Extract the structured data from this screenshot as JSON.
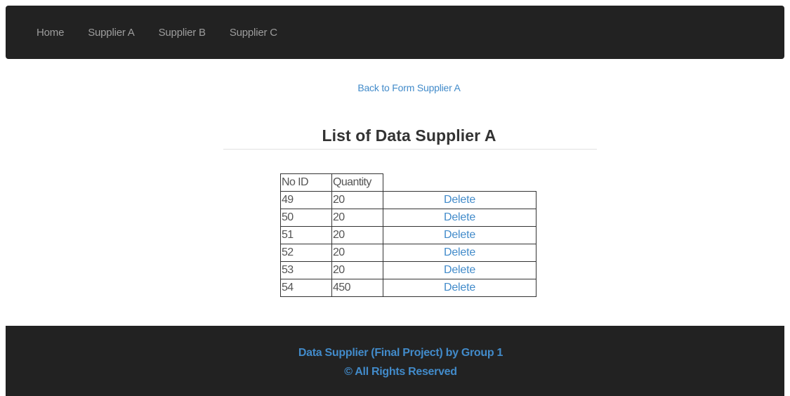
{
  "navbar": {
    "items": [
      {
        "label": "Home"
      },
      {
        "label": "Supplier A"
      },
      {
        "label": "Supplier B"
      },
      {
        "label": "Supplier C"
      }
    ]
  },
  "back_link": "Back to Form Supplier A",
  "title": "List of Data Supplier A",
  "table": {
    "headers": [
      "No ID",
      "Quantity"
    ],
    "rows": [
      {
        "id": "49",
        "quantity": "20",
        "action": "Delete"
      },
      {
        "id": "50",
        "quantity": "20",
        "action": "Delete"
      },
      {
        "id": "51",
        "quantity": "20",
        "action": "Delete"
      },
      {
        "id": "52",
        "quantity": "20",
        "action": "Delete"
      },
      {
        "id": "53",
        "quantity": "20",
        "action": "Delete"
      },
      {
        "id": "54",
        "quantity": "450",
        "action": "Delete"
      }
    ]
  },
  "footer": {
    "line1": "Data Supplier (Final Project) by Group 1",
    "line2": "© All Rights Reserved"
  },
  "colors": {
    "navbar_bg": "#222222",
    "link": "#428bca",
    "nav_text": "#9d9d9d"
  }
}
